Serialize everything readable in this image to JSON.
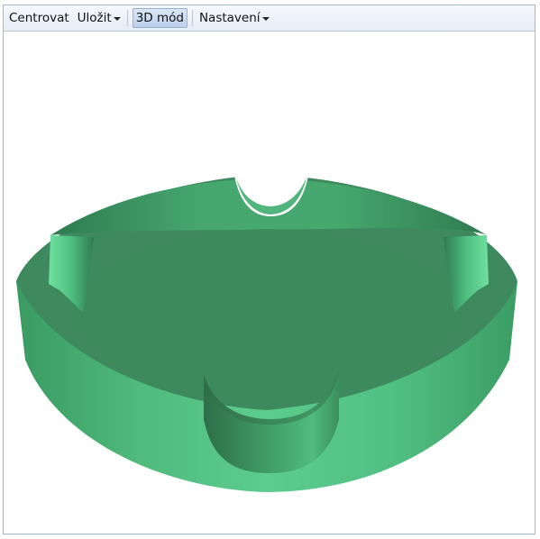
{
  "toolbar": {
    "center_label": "Centrovat",
    "save_label": "Uložit",
    "mode3d_label": "3D mód",
    "settings_label": "Nastavení"
  },
  "colors": {
    "toolbar_bg": "#e8eef7",
    "frame_border": "#9eb6d6",
    "model_top": "#3e8a5e",
    "model_side_light": "#57c485",
    "model_side_dark": "#2f6e49"
  },
  "viewport": {
    "model": "ashtray-3d-model"
  }
}
